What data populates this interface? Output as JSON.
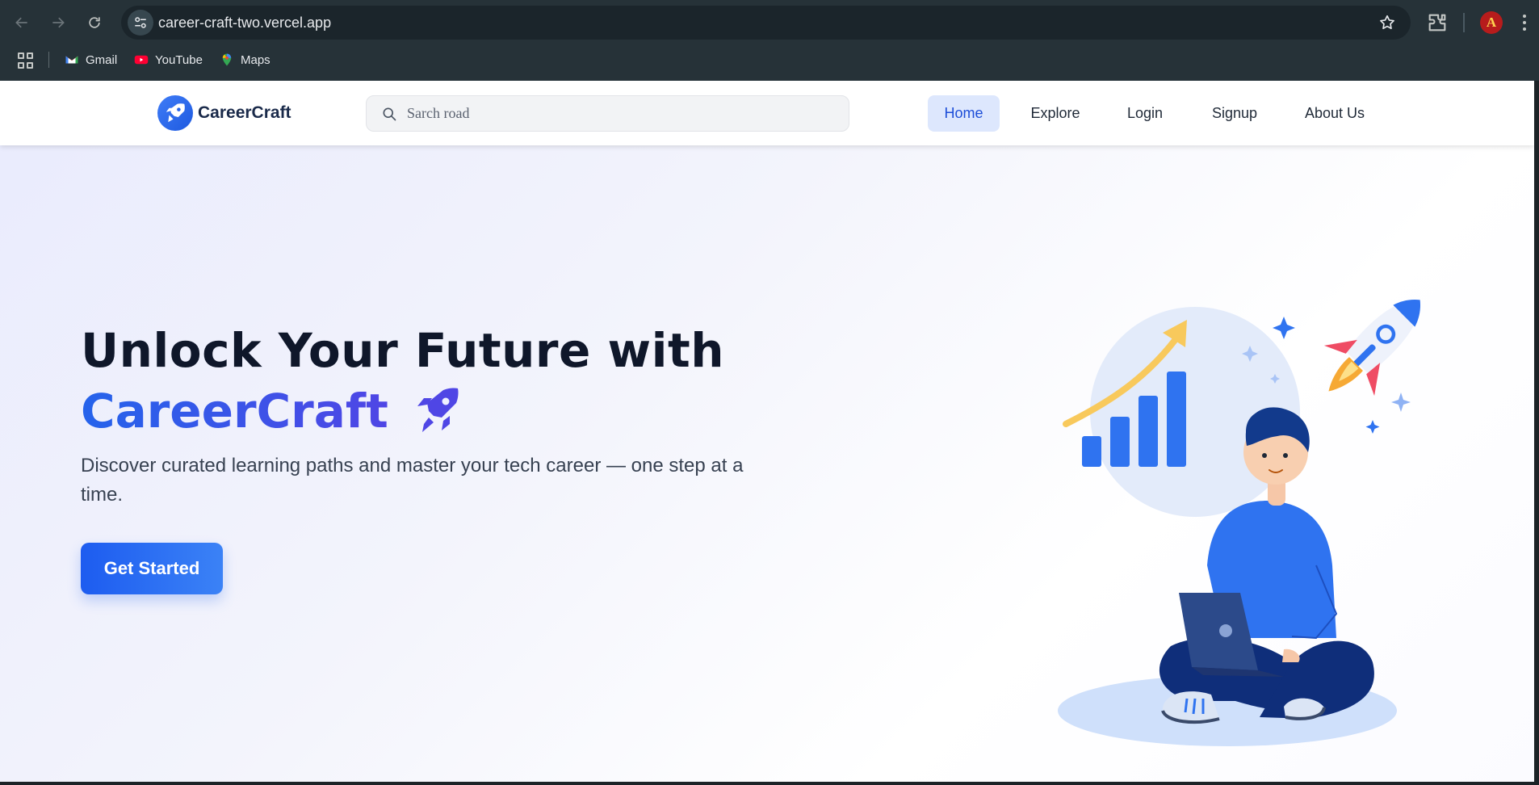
{
  "browser": {
    "url": "career-craft-two.vercel.app",
    "bookmarks": [
      {
        "label": "Gmail",
        "icon": "gmail-icon"
      },
      {
        "label": "YouTube",
        "icon": "youtube-icon"
      },
      {
        "label": "Maps",
        "icon": "maps-icon"
      }
    ],
    "profile_initial": "A"
  },
  "site": {
    "brand": "CareerCraft",
    "search_placeholder": "Sarch road",
    "nav": [
      {
        "label": "Home",
        "active": true
      },
      {
        "label": "Explore",
        "active": false
      },
      {
        "label": "Login",
        "active": false
      },
      {
        "label": "Signup",
        "active": false
      },
      {
        "label": "About Us",
        "active": false
      }
    ]
  },
  "hero": {
    "title_line1": "Unlock Your Future with",
    "title_brand": "CareerCraft",
    "description": "Discover curated learning paths and master your tech career — one step at a time.",
    "cta_label": "Get Started"
  },
  "colors": {
    "chrome_bg": "#263238",
    "accent": "#2563eb",
    "active_nav_bg": "#dde7fd",
    "title_text": "#0f172a"
  }
}
